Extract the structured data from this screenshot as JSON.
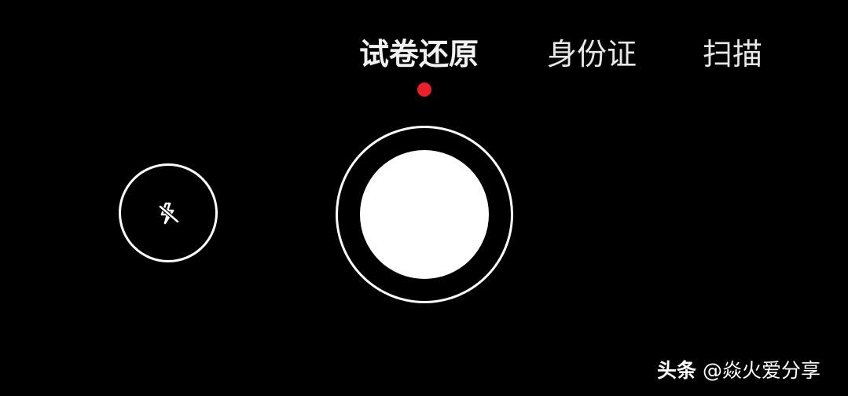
{
  "modes": {
    "tabs": [
      {
        "label": "试卷还原",
        "active": true
      },
      {
        "label": "身份证",
        "active": false
      },
      {
        "label": "扫描",
        "active": false
      }
    ],
    "active_indicator_color": "#e8212b"
  },
  "controls": {
    "flash_icon": "flash-off-icon",
    "shutter": "shutter"
  },
  "watermark": {
    "brand": "头条",
    "handle": "@焱火爱分享"
  }
}
